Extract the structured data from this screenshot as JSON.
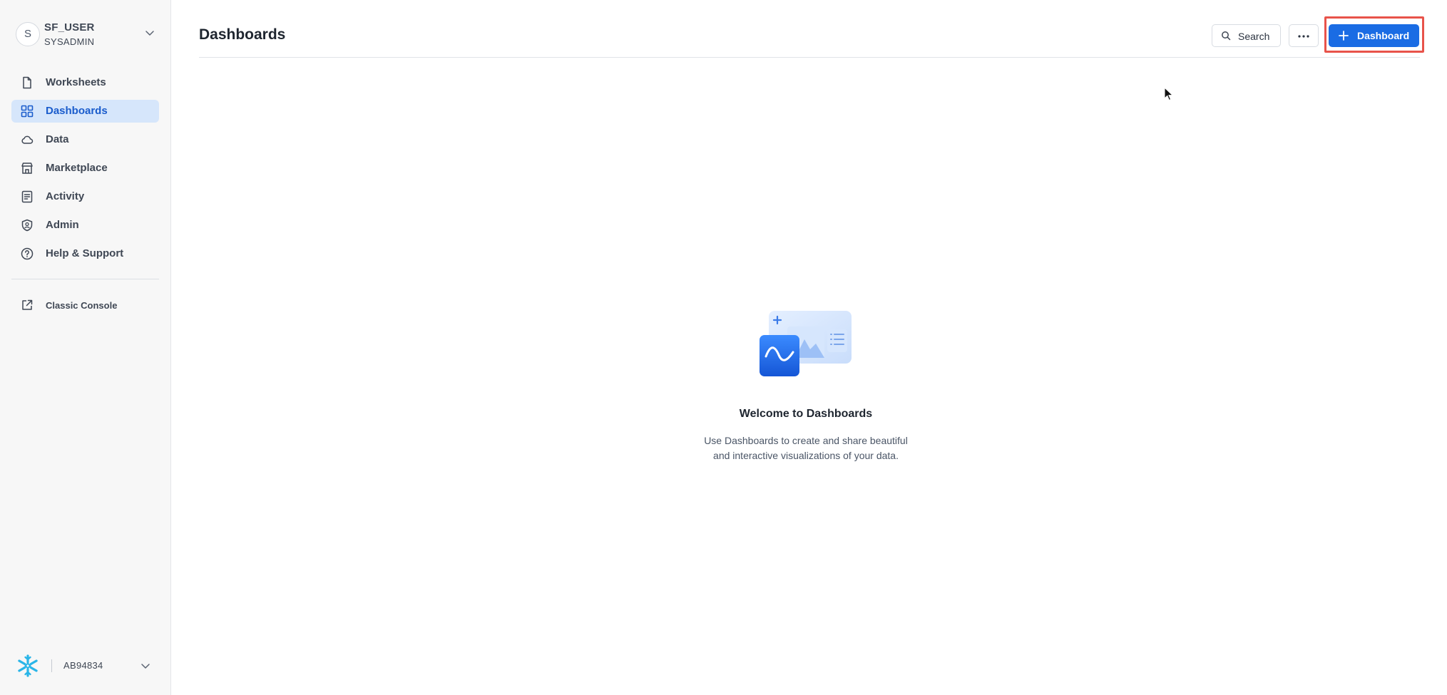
{
  "user": {
    "avatar_initial": "S",
    "name": "SF_USER",
    "role": "SYSADMIN"
  },
  "sidebar": {
    "items": [
      {
        "label": "Worksheets",
        "icon": "document-icon",
        "active": false
      },
      {
        "label": "Dashboards",
        "icon": "grid-icon",
        "active": true
      },
      {
        "label": "Data",
        "icon": "cloud-icon",
        "active": false
      },
      {
        "label": "Marketplace",
        "icon": "storefront-icon",
        "active": false
      },
      {
        "label": "Activity",
        "icon": "activity-log-icon",
        "active": false
      },
      {
        "label": "Admin",
        "icon": "shield-icon",
        "active": false
      },
      {
        "label": "Help & Support",
        "icon": "help-circle-icon",
        "active": false
      }
    ],
    "classic_console_label": "Classic Console",
    "account_id": "AB94834"
  },
  "header": {
    "title": "Dashboards",
    "search_label": "Search",
    "new_dashboard_label": "Dashboard"
  },
  "empty_state": {
    "title": "Welcome to Dashboards",
    "description_line1": "Use Dashboards to create and share beautiful",
    "description_line2": "and interactive visualizations of your data."
  },
  "colors": {
    "accent": "#1a6ce4",
    "active_nav_bg": "#d6e6fb",
    "active_nav_text": "#1a5ccc",
    "highlight": "#e8534a",
    "snowflake_brand": "#29b5e8"
  }
}
